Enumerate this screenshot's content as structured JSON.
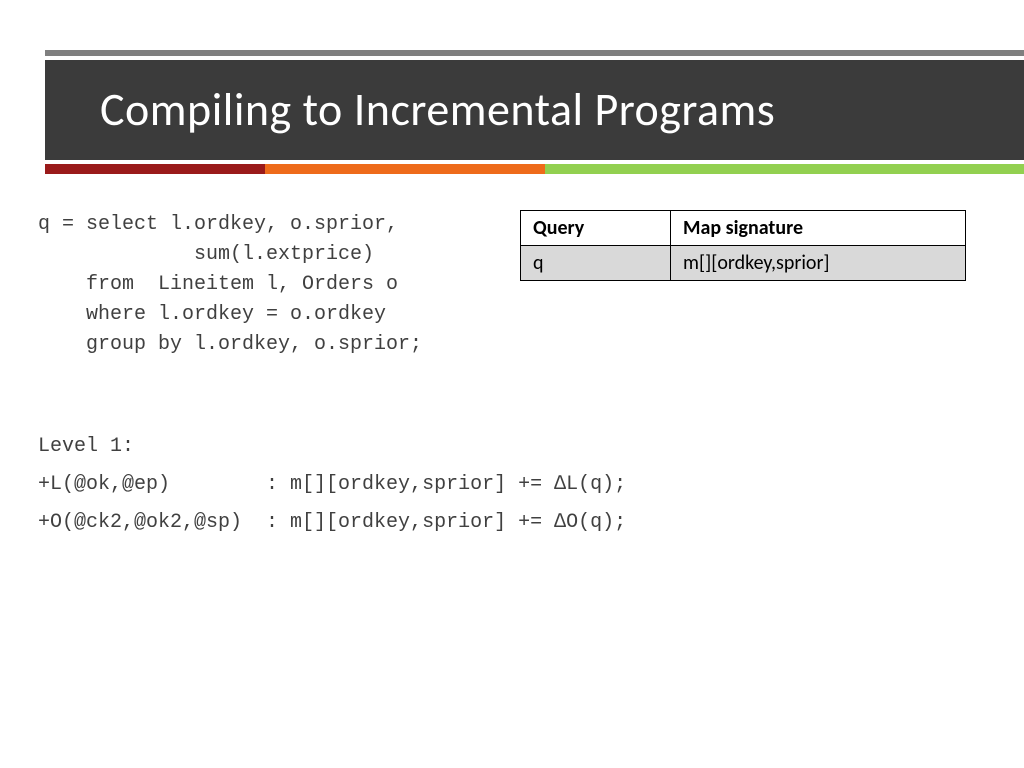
{
  "title": "Compiling to Incremental Programs",
  "query_code": "q = select l.ordkey, o.sprior,\n             sum(l.extprice)\n    from  Lineitem l, Orders o\n    where l.ordkey = o.ordkey\n    group by l.ordkey, o.sprior;",
  "table": {
    "headers": {
      "c0": "Query",
      "c1": "Map signature"
    },
    "rows": [
      {
        "c0": "q",
        "c1": "m[][ordkey,sprior]"
      }
    ]
  },
  "level_block": "Level 1:\n+L(@ok,@ep)        : m[][ordkey,sprior] += ∆L(q);\n+O(@ck2,@ok2,@sp)  : m[][ordkey,sprior] += ∆O(q);"
}
